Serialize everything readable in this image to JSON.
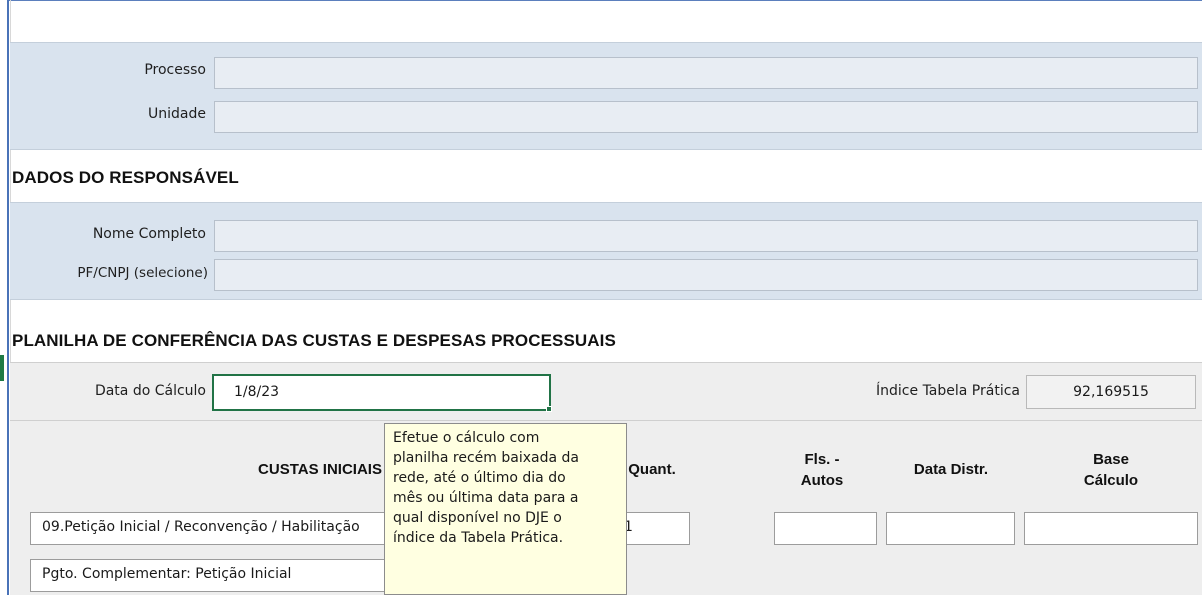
{
  "processo": {
    "label": "Processo",
    "value": ""
  },
  "unidade": {
    "label": "Unidade",
    "value": ""
  },
  "responsavel": {
    "title": "DADOS DO RESPONSÁVEL",
    "nome_label": "Nome Completo",
    "nome_value": "",
    "pf_label": "PF/CNPJ (selecione)",
    "pf_value": ""
  },
  "planilha": {
    "title": "PLANILHA DE CONFERÊNCIA DAS CUSTAS E DESPESAS PROCESSUAIS",
    "data_label": "Data do Cálculo",
    "data_value": "1/8/23",
    "indice_label": "Índice Tabela Prática",
    "indice_value": "92,169515"
  },
  "table": {
    "header_custas": "CUSTAS INICIAIS",
    "header_quant": "Quant.",
    "header_fls_line1": "Fls. -",
    "header_fls_line2": "Autos",
    "header_data": "Data Distr.",
    "header_base_line1": "Base",
    "header_base_line2": "Cálculo",
    "rows": [
      {
        "desc": "09.Petição Inicial / Reconvenção / Habilitação",
        "quant": "1"
      },
      {
        "desc": "Pgto. Complementar: Petição Inicial",
        "quant": ""
      }
    ]
  },
  "tooltip": {
    "lines": [
      "Efetue o cálculo com",
      "planilha recém baixada da",
      "rede, até o último dia do",
      "mês ou última data para a",
      "qual disponível no DJE o",
      "índice da Tabela Prática."
    ]
  }
}
